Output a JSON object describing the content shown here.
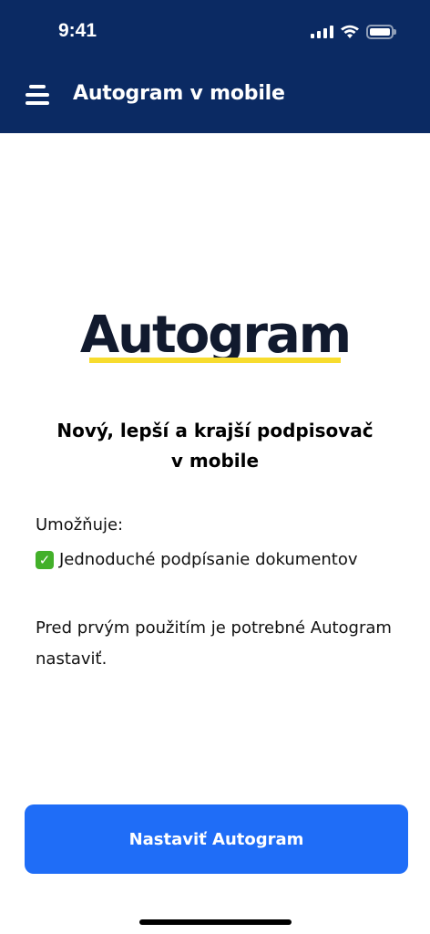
{
  "status_bar": {
    "time": "9:41",
    "icons": [
      "signal-icon",
      "wifi-icon",
      "battery-icon"
    ]
  },
  "header": {
    "menu_icon": "hamburger-menu-icon",
    "title": "Autogram v mobile",
    "background_color": "#0b2a63"
  },
  "logo": {
    "text": "Autogram",
    "underline_color": "#f7dc2e"
  },
  "main": {
    "headline_line1": "Nový, lepší a krajší podpisovač",
    "headline_line2": "v mobile",
    "allows_label": "Umožňuje:",
    "feature_icon": "checkmark-icon",
    "feature_text": "Jednoduché podpísanie dokumentov",
    "setup_note": "Pred prvým použitím je potrebné Autogram nastaviť."
  },
  "actions": {
    "setup_button_label": "Nastaviť Autogram",
    "button_color": "#1f6df7"
  }
}
